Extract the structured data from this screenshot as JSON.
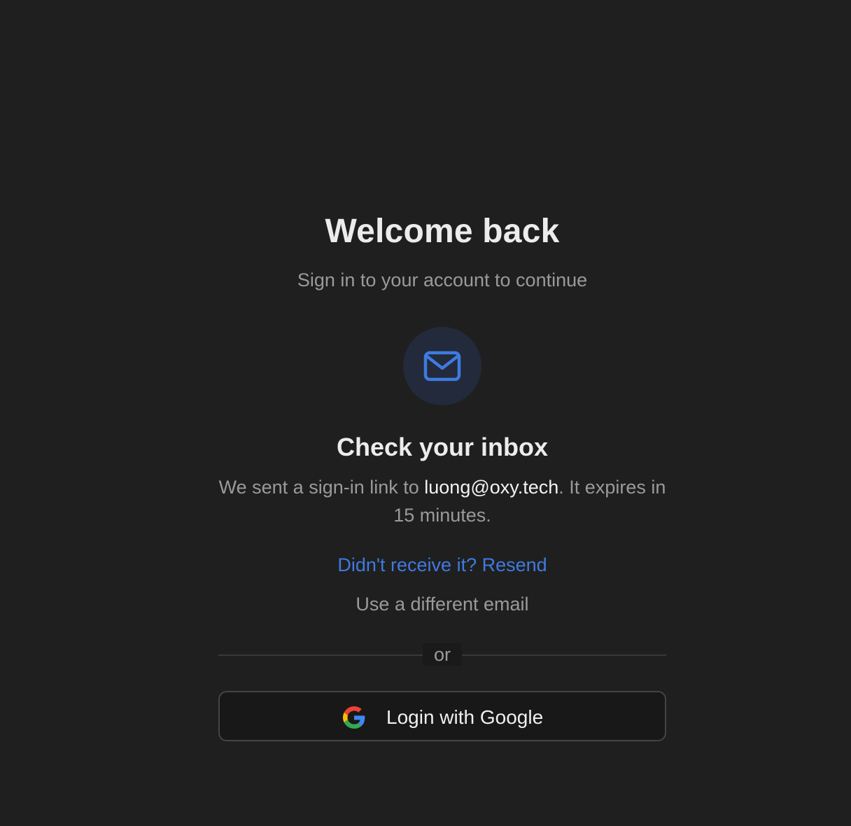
{
  "header": {
    "title": "Welcome back",
    "subtitle": "Sign in to your account to continue"
  },
  "mail_icon": {
    "icon": "mail-icon",
    "accent_color": "#3f7ae0"
  },
  "inbox": {
    "title": "Check your inbox",
    "message_prefix": "We sent a sign-in link to ",
    "email": "luong@oxy.tech",
    "message_suffix": ". It expires in 15 minutes."
  },
  "actions": {
    "resend_label": "Didn't receive it? Resend",
    "different_email_label": "Use a different email"
  },
  "divider": {
    "label": "or"
  },
  "google": {
    "icon": "google-icon",
    "label": "Login with Google"
  }
}
